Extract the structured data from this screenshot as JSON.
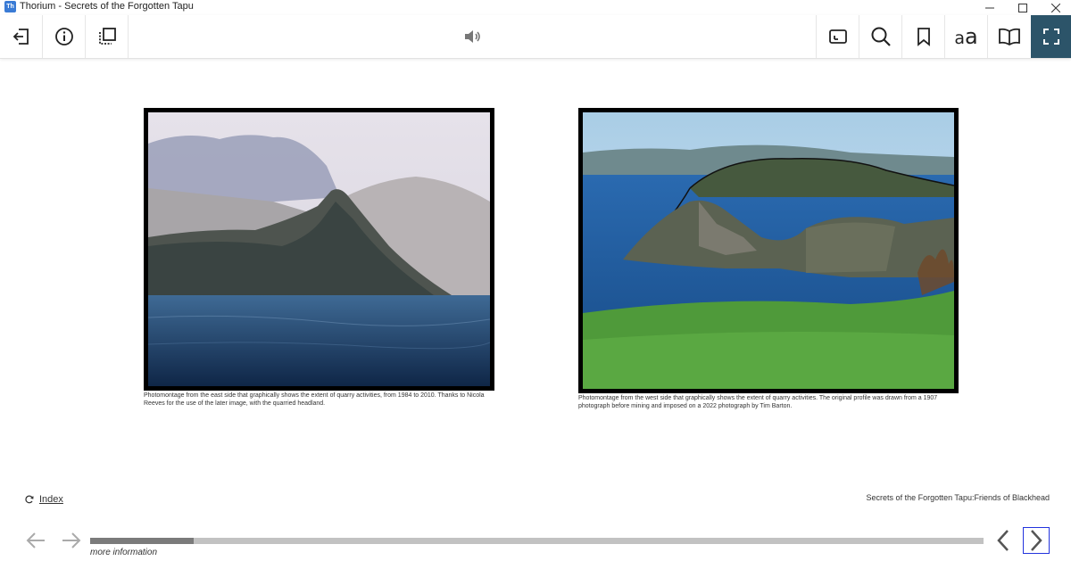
{
  "window": {
    "app_badge": "Th",
    "title": "Thorium - Secrets of the Forgotten Tapu"
  },
  "toolbar": {
    "left": [
      {
        "name": "back-to-library-button",
        "icon": "exit-icon"
      },
      {
        "name": "info-button",
        "icon": "info-icon"
      },
      {
        "name": "navigation-button",
        "icon": "toc-icon"
      }
    ],
    "center": {
      "name": "read-aloud-button",
      "icon": "speaker-icon"
    },
    "right": [
      {
        "name": "fit-screen-button",
        "icon": "fit-icon"
      },
      {
        "name": "search-button",
        "icon": "search-icon"
      },
      {
        "name": "bookmark-button",
        "icon": "bookmark-icon"
      },
      {
        "name": "text-settings-button",
        "icon": "text-size-icon",
        "label_small": "a",
        "label_big": "a"
      },
      {
        "name": "reading-mode-button",
        "icon": "book-icon"
      },
      {
        "name": "fullscreen-button",
        "icon": "fullscreen-icon",
        "active": true
      }
    ]
  },
  "content": {
    "left_figure": {
      "caption": "Photomontage from the east side that graphically shows the extent of quarry activities, from 1984 to 2010. Thanks to Nicola Reeves for the use of the later image, with the quarried headland."
    },
    "right_figure": {
      "caption": "Photomontage from the west side that graphically shows the extent of quarry activities. The original profile was drawn from a 1907 photograph before mining and imposed on a 2022 photograph by Tim Barton."
    }
  },
  "footer": {
    "index_label": "Index",
    "book_title": "Secrets of the Forgotten Tapu:Friends of Blackhead"
  },
  "navigation": {
    "progress": 0.116,
    "more_info_label": "more information"
  },
  "colors": {
    "active_toolbar": "#2c5469",
    "focus_ring": "#2233dd"
  }
}
